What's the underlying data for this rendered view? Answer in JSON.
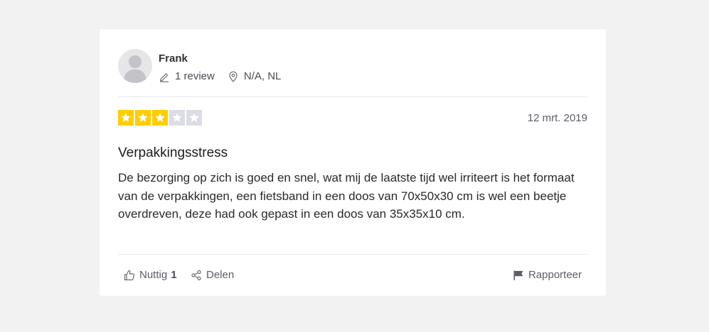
{
  "consumer": {
    "name": "Frank",
    "review_count": "1 review",
    "location": "N/A, NL"
  },
  "review": {
    "rating": 3,
    "max_rating": 5,
    "date": "12 mrt. 2019",
    "title": "Verpakkingsstress",
    "body": "De bezorging op zich is goed en snel, wat mij de laatste tijd wel irriteert is het formaat van de verpakkingen, een fietsband in een doos van 70x50x30 cm is wel een beetje overdreven, deze had ook gepast in een doos van 35x35x10 cm."
  },
  "actions": {
    "useful_label": "Nuttig",
    "useful_count": "1",
    "share_label": "Delen",
    "report_label": "Rapporteer"
  },
  "icons": {
    "avatar": "avatar-placeholder-icon",
    "review_count": "pencil-icon",
    "location": "location-pin-icon",
    "useful": "thumbs-up-icon",
    "share": "share-icon",
    "report": "flag-icon",
    "star": "star-icon"
  },
  "colors": {
    "background": "#f2f2f3",
    "card": "#ffffff",
    "star_filled": "#ffce00",
    "star_empty": "#dcdce6",
    "text_primary": "#1c1c1c",
    "text_secondary": "#5c5c66"
  }
}
